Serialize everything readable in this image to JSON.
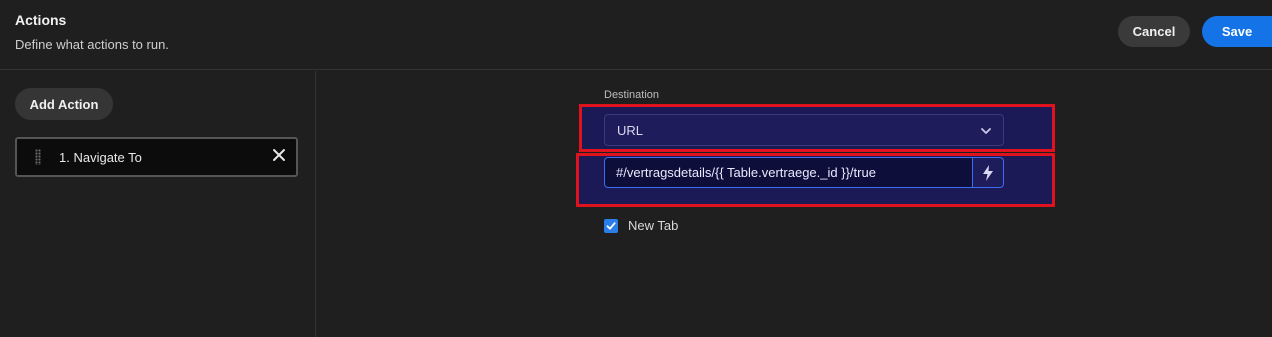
{
  "header": {
    "title": "Actions",
    "subtitle": "Define what actions to run.",
    "cancel_label": "Cancel",
    "save_label": "Save"
  },
  "sidebar": {
    "add_action_label": "Add Action",
    "items": [
      {
        "label": "1. Navigate To"
      }
    ]
  },
  "main": {
    "destination_label": "Destination",
    "destination_select_value": "URL",
    "url_value": "#/vertragsdetails/{{ Table.vertraege._id }}/true",
    "new_tab_label": "New Tab",
    "new_tab_checked": true
  },
  "colors": {
    "accent": "#1473e6",
    "highlight_border": "#e0121e",
    "panel_bg": "#1c1a56",
    "background": "#1f1f1f"
  },
  "icons": [
    "drag-handle-icon",
    "close-icon",
    "chevron-down-icon",
    "lightning-icon",
    "checkmark-icon"
  ]
}
